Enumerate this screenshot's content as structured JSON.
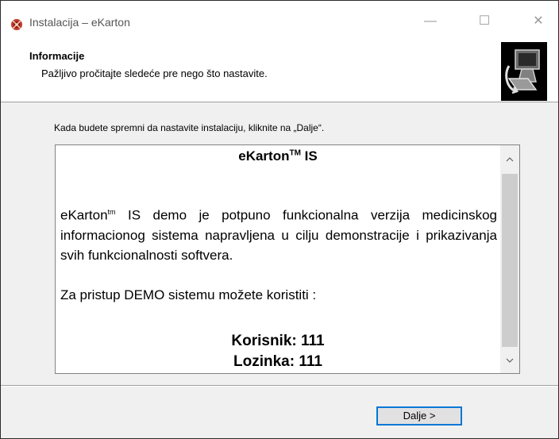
{
  "window": {
    "title": "Instalacija – eKarton",
    "minimize_glyph": "—",
    "maximize_glyph": "☐",
    "close_glyph": "✕",
    "app_icon": "ekarton-app-icon"
  },
  "header": {
    "title": "Informacije",
    "subtitle": "Pažljivo pročitajte sledeće pre nego što nastavite.",
    "image_icon": "installer-computer-icon"
  },
  "instruction": "Kada budete spremni da nastavite instalaciju, kliknite na „Dalje“.",
  "info_text": {
    "title_main": "eKarton",
    "title_sup": "TM",
    "title_suffix": " IS",
    "para_name": "eKarton",
    "para_sup": "tm",
    "para_rest": " IS demo je potpuno funkcionalna verzija medicinskog informacionog sistema napravljena u cilju demonstracije i prikazivanja svih funkcionalnosti softvera.",
    "access_line": "Za pristup DEMO sistemu možete koristiti :",
    "user_line": "Korisnik: 111",
    "pass_line": "Lozinka: 111"
  },
  "scrollbar": {
    "up_glyph": "^",
    "down_glyph": "v"
  },
  "buttons": {
    "next_label": "Dalje >"
  }
}
